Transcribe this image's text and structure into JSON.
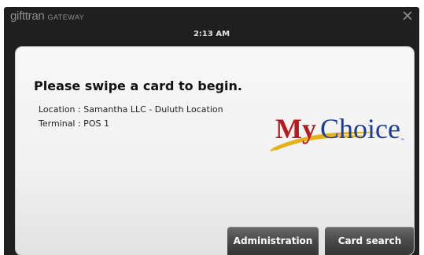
{
  "app": {
    "brand_name": "gifttran",
    "brand_sub": "GATEWAY",
    "clock": "2:13 AM",
    "close_icon": "close-icon"
  },
  "dialog": {
    "title": "Please swipe a card to begin.",
    "location": "Location : Samantha LLC - Duluth Location",
    "terminal": "Terminal : POS 1",
    "logo_text": "MyChoice",
    "logo_colors": {
      "my": "#b01e23",
      "choice": "#1f3f8c",
      "swoosh": "#e4b21a"
    }
  },
  "buttons": {
    "administration": "Administration",
    "card_search": "Card search"
  }
}
